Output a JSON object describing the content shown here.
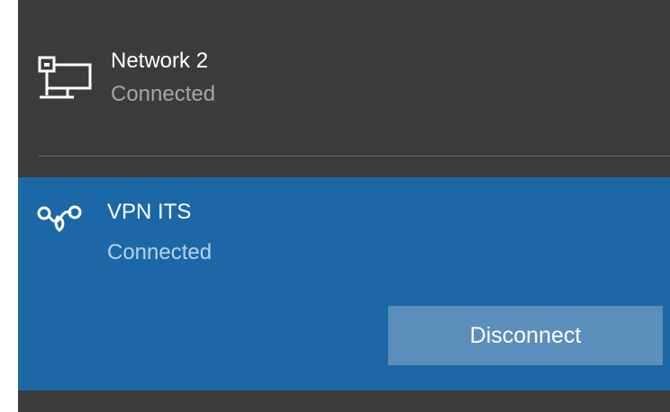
{
  "network": {
    "name": "Network  2",
    "status": "Connected",
    "icon": "wired-network-icon"
  },
  "vpn": {
    "name": "VPN ITS",
    "status": "Connected",
    "icon": "vpn-icon",
    "disconnect_label": "Disconnect"
  },
  "colors": {
    "panel_background": "#3b3b3b",
    "selected_background": "#1c68a7",
    "button_background": "#5b8eba",
    "secondary_text": "#a6a6a6"
  }
}
